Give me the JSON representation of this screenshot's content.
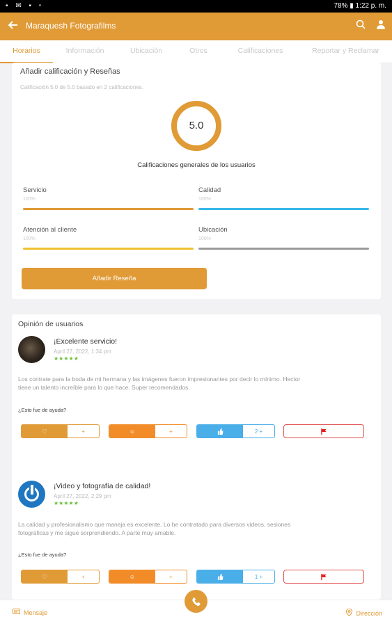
{
  "status_bar": {
    "left_icons": "▪ ✉ ▪ ▫",
    "time": "78% ▮ 1:22 p. m."
  },
  "app_bar": {
    "title": "Maraquesh Fotografilms"
  },
  "tabs": [
    {
      "label": "Horarios",
      "active": true
    },
    {
      "label": "Información"
    },
    {
      "label": "Ubicación"
    },
    {
      "label": "Otros"
    },
    {
      "label": "Calificaciones"
    },
    {
      "label": "Reportar y Reclamar"
    }
  ],
  "rating_card": {
    "title": "Añadir calificación y Reseñas",
    "summary": "Calificación 5.0 de 5.0 basado en 2 calificaciones.",
    "score": "5.0",
    "overall_label": "Calificaciones generales de los usuarios",
    "metrics": [
      {
        "label": "Servicio",
        "pct": "100%",
        "color": "#e09a36"
      },
      {
        "label": "Calidad",
        "pct": "100%",
        "color": "#3ab8e8"
      },
      {
        "label": "Atención al cliente",
        "pct": "100%",
        "color": "#f0c030"
      },
      {
        "label": "Ubicación",
        "pct": "100%",
        "color": "#9a9a9a"
      }
    ],
    "add_button": "Añadir Reseña"
  },
  "reviews_card": {
    "title": "Opinión de usuarios",
    "reviews": [
      {
        "title": "¡Excelente servicio!",
        "date": "April 27, 2022, 1:34 pm",
        "stars": "★★★★★",
        "text_line1": "Los contrate para la boda de mi hermana y las imágenes fueron impresionantes por decir lo mínimo. Hector",
        "text_line2": "tiene un talento increíble para lo que hace. Super recomendados.",
        "helpful": "¿Esto fue de ayuda?",
        "count_like": "+",
        "count_funny": "+",
        "count_thumb": "2 +"
      },
      {
        "title": "¡Video y fotografía de calidad!",
        "date": "April 27, 2022, 2:29 pm",
        "stars": "★★★★★",
        "text_line1": "La calidad y profesionalismo que maneja es excelente. Lo he contratado para diversos videos, sesiones",
        "text_line2": "fotográficas y me sigue sorprendiendo. A parte muy amable.",
        "helpful": "¿Esto fue de ayuda?",
        "count_like": "+",
        "count_funny": "+",
        "count_thumb": "1 +"
      }
    ]
  },
  "bottom_bar": {
    "message": "Mensaje",
    "direction": "Dirección"
  },
  "icons": {
    "back": "arrow-left-icon",
    "search": "search-icon",
    "user": "user-icon",
    "phone": "phone-icon",
    "heart": "heart-icon",
    "smile": "smile-icon",
    "thumb": "thumbs-up-icon",
    "flag": "flag-icon",
    "chat": "chat-icon",
    "pin": "location-pin-icon"
  }
}
